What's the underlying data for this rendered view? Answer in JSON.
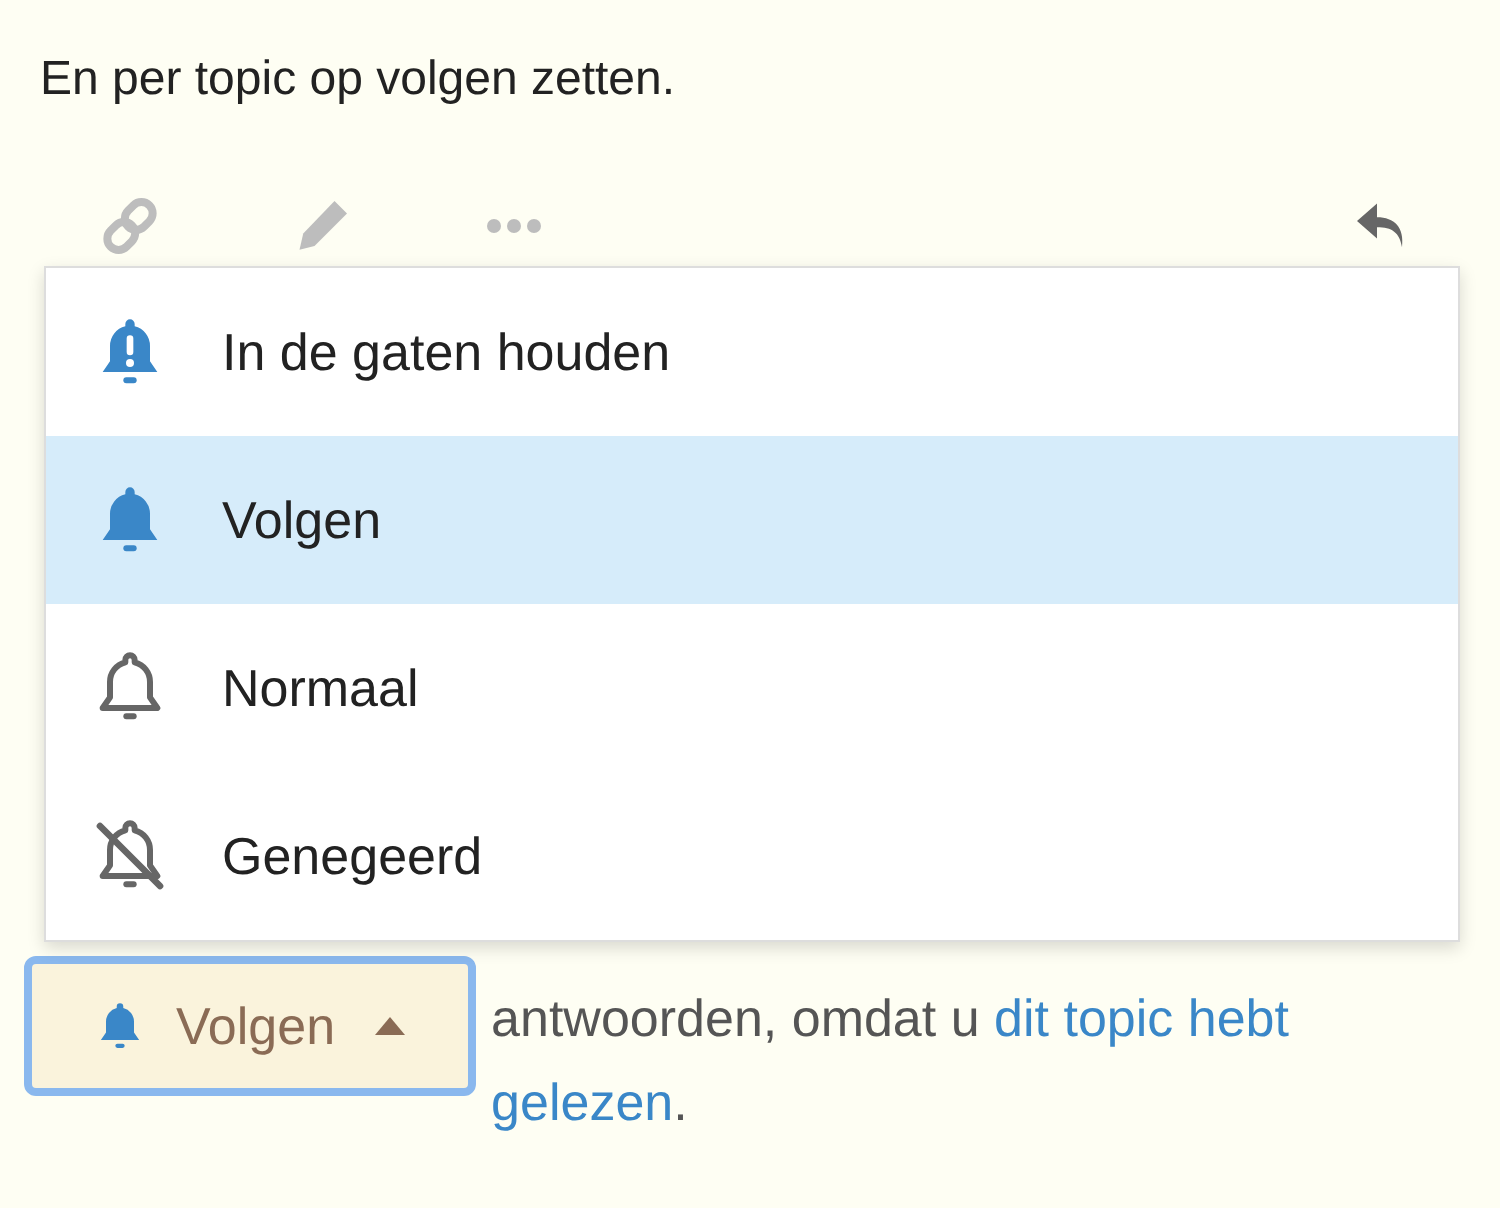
{
  "intro": "En per topic op volgen zetten.",
  "toolbar": [
    {
      "kind": "link"
    },
    {
      "kind": "edit"
    },
    {
      "kind": "more"
    },
    {
      "kind": "reply"
    }
  ],
  "menu": {
    "items": [
      {
        "label": "In de gaten houden",
        "kind": "alert",
        "selected": false
      },
      {
        "label": "Volgen",
        "kind": "bell",
        "selected": true
      },
      {
        "label": "Normaal",
        "kind": "outline",
        "selected": false
      },
      {
        "label": "Genegeerd",
        "kind": "muted",
        "selected": false
      }
    ]
  },
  "button": {
    "label": "Volgen",
    "kind": "bell",
    "focused": true
  },
  "explanation": {
    "lines": [
      {
        "text": "antwoorden, omdat u ",
        "link": "dit topic hebt"
      },
      {
        "link": "gelezen",
        "after": "."
      }
    ]
  }
}
